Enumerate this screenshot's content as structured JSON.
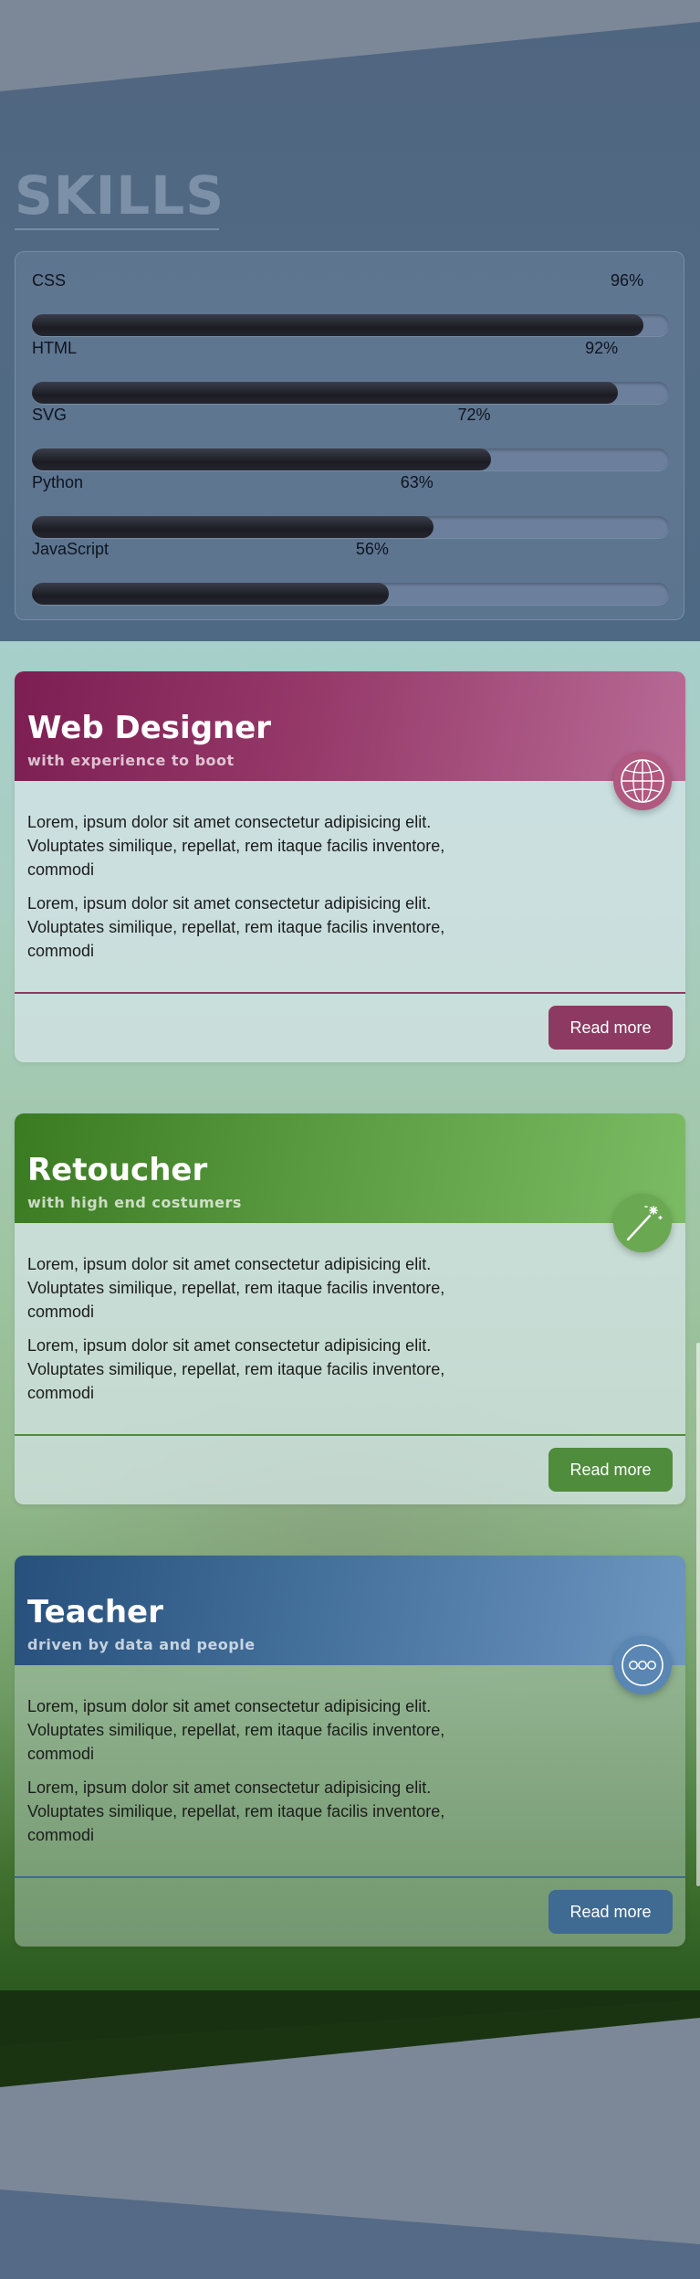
{
  "skills": {
    "title": "SKILLS",
    "items": [
      {
        "name": "CSS",
        "value": 96,
        "label": "96%"
      },
      {
        "name": "HTML",
        "value": 92,
        "label": "92%"
      },
      {
        "name": "SVG",
        "value": 72,
        "label": "72%"
      },
      {
        "name": "Python",
        "value": 63,
        "label": "63%"
      },
      {
        "name": "JavaScript",
        "value": 56,
        "label": "56%"
      }
    ]
  },
  "cards": [
    {
      "title": "Web Designer",
      "subtitle": "with experience to boot",
      "paragraphs": [
        "Lorem, ipsum dolor sit amet consectetur adipisicing elit. Voluptates similique, repellat, rem itaque facilis inventore, commodi",
        "Lorem, ipsum dolor sit amet consectetur adipisicing elit. Voluptates similique, repellat, rem itaque facilis inventore, commodi"
      ],
      "button": "Read more",
      "icon": "globe-icon",
      "color": "#8c3a62"
    },
    {
      "title": "Retoucher",
      "subtitle": "with high end costumers",
      "paragraphs": [
        "Lorem, ipsum dolor sit amet consectetur adipisicing elit. Voluptates similique, repellat, rem itaque facilis inventore, commodi",
        "Lorem, ipsum dolor sit amet consectetur adipisicing elit. Voluptates similique, repellat, rem itaque facilis inventore, commodi"
      ],
      "button": "Read more",
      "icon": "magic-wand-icon",
      "color": "#4f8c3c"
    },
    {
      "title": "Teacher",
      "subtitle": "driven by data and people",
      "paragraphs": [
        "Lorem, ipsum dolor sit amet consectetur adipisicing elit. Voluptates similique, repellat, rem itaque facilis inventore, commodi",
        "Lorem, ipsum dolor sit amet consectetur adipisicing elit. Voluptates similique, repellat, rem itaque facilis inventore, commodi"
      ],
      "button": "Read more",
      "icon": "ellipsis-circle-icon",
      "color": "#3f6a92"
    }
  ]
}
